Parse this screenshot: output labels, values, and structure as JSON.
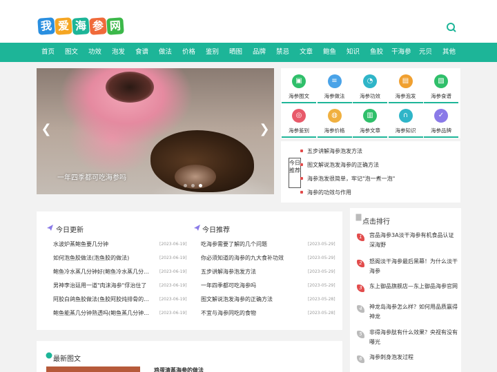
{
  "site": {
    "logo_chars": [
      "我",
      "爱",
      "海",
      "参",
      "网"
    ],
    "logo_colors": [
      "#2a8fe0",
      "#f5a623",
      "#1db598",
      "#f06a3a",
      "#3cb84a"
    ],
    "accent": "#1db598"
  },
  "nav": [
    "首页",
    "图文",
    "功效",
    "泡发",
    "食谱",
    "做法",
    "价格",
    "鉴别",
    "晒图",
    "品牌",
    "禁忌",
    "文章",
    "鲍鱼",
    "知识",
    "鱼胶",
    "干海参",
    "元贝",
    "其他"
  ],
  "banner": {
    "caption": "一年四季都可吃海参吗"
  },
  "categories": [
    {
      "label": "海参图文",
      "icon": "image-icon",
      "color": "#2fbf6a"
    },
    {
      "label": "海参做法",
      "icon": "list-icon",
      "color": "#4aa3e8"
    },
    {
      "label": "海参功效",
      "icon": "chat-icon",
      "color": "#2fb5c8"
    },
    {
      "label": "海参泡发",
      "icon": "folder-icon",
      "color": "#f0a030"
    },
    {
      "label": "海参食谱",
      "icon": "picture-icon",
      "color": "#2fbf6a"
    },
    {
      "label": "海参鉴别",
      "icon": "target-icon",
      "color": "#e85a6a"
    },
    {
      "label": "海参价格",
      "icon": "globe-icon",
      "color": "#f0b040"
    },
    {
      "label": "海参文章",
      "icon": "document-icon",
      "color": "#2fbf6a"
    },
    {
      "label": "海参知识",
      "icon": "headphone-icon",
      "color": "#2fb5c8"
    },
    {
      "label": "海参品牌",
      "icon": "check-icon",
      "color": "#8a7ae8"
    }
  ],
  "today_tag": "今日推荐",
  "today_picks": [
    "五步讲解海参泡发方法",
    "图文解说泡发海参的正确方法",
    "海参泡发很简单，牢记\"泡一煮一泡\"",
    "海参的功效与作用"
  ],
  "latest": {
    "title": "今日更新",
    "items": [
      {
        "text": "水波炉蒸鲍鱼要几分钟",
        "date": "[2023-06-19]"
      },
      {
        "text": "如何泡鱼胶做法(泡鱼胶的做法)",
        "date": "[2023-06-19]"
      },
      {
        "text": "鲍鱼冷水蒸几分钟好(鲍鱼冷水蒸几分...",
        "date": "[2023-06-19]"
      },
      {
        "text": "男神李治廷用一道\"肉沫海参\"俘治住了",
        "date": "[2023-06-19]"
      },
      {
        "text": "阿胶白鸽鱼胶做法(鱼胶阿胶炖排骨的...",
        "date": "[2023-06-19]"
      },
      {
        "text": "鲍鱼能蒸几分钟熟透吗(鲍鱼蒸几分钟...",
        "date": "[2023-06-19]"
      }
    ]
  },
  "recommend": {
    "title": "今日推荐",
    "items": [
      {
        "text": "吃海参需要了解的几个问题",
        "date": "[2023-05-29]"
      },
      {
        "text": "你必须知道的海参的九大食补功效",
        "date": "[2023-05-29]"
      },
      {
        "text": "五步讲解海参泡发方法",
        "date": "[2023-05-29]"
      },
      {
        "text": "一年四季都可吃海参吗",
        "date": "[2023-05-29]"
      },
      {
        "text": "图文解说泡发海参的正确方法",
        "date": "[2023-05-28]"
      },
      {
        "text": "不宜与海参同吃的食物",
        "date": "[2023-05-28]"
      }
    ]
  },
  "ranking": {
    "title": "点击排行",
    "items": [
      {
        "num": "1",
        "text": "宫品海参3A淡干海参有机食品认证深海野",
        "color": "#e24c4c"
      },
      {
        "num": "2",
        "text": "怒阁淡干海参最后黑幕！为什么淡干海参",
        "color": "#e24c4c"
      },
      {
        "num": "3",
        "text": "东上御品旗舰店—东上御品海参官网",
        "color": "#e24c4c"
      },
      {
        "num": "4",
        "text": "神龙岛海参怎么样？如何用品质赢得神龙",
        "color": "#bbbbbb"
      },
      {
        "num": "5",
        "text": "非得海参肽有什么效果？央视有没有曝光",
        "color": "#bbbbbb"
      },
      {
        "num": "6",
        "text": "海参刺身泡发过程",
        "color": "#bbbbbb"
      }
    ]
  },
  "newpic": {
    "title": "最新图文",
    "first_article": "鸡蛋清蒸海参的做法"
  }
}
